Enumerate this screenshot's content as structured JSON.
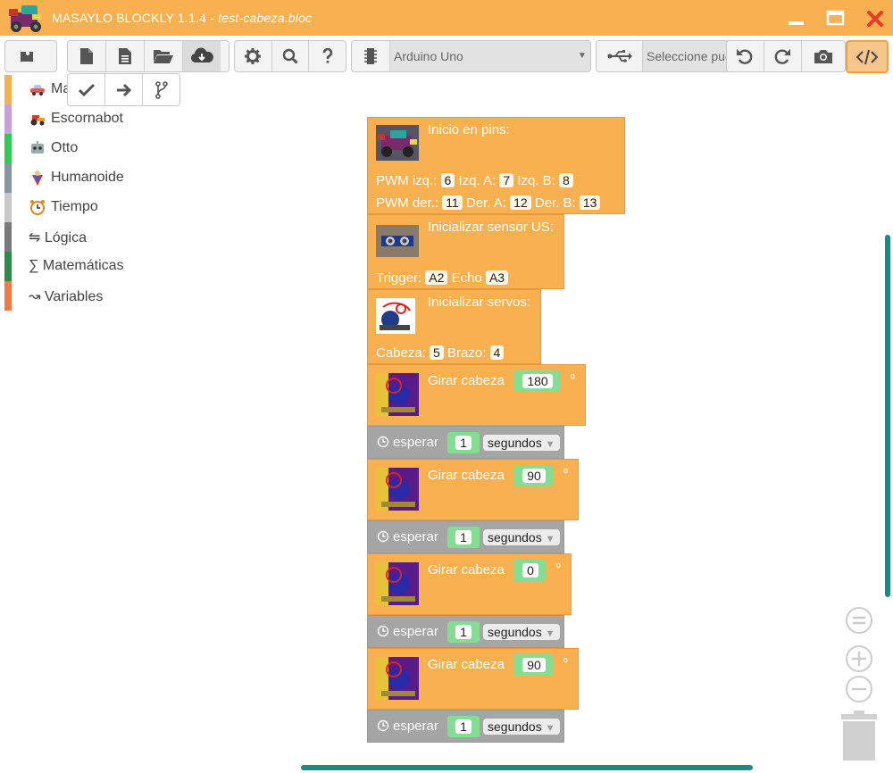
{
  "window": {
    "title": "MASAYLO BLOCKLY 1.1.4 - ",
    "file": "test-cabeza.bloc"
  },
  "toolbar": {
    "board_value": "Arduino Uno",
    "port_placeholder": "Seleccione puerto"
  },
  "categories": [
    {
      "label": "Masaylo",
      "color": "#f9b050"
    },
    {
      "label": "Escornabot",
      "color": "#c9a0dc"
    },
    {
      "label": "Otto",
      "color": "#2ecc52"
    },
    {
      "label": "Humanoide",
      "color": "#8795a5"
    },
    {
      "label": "Tiempo",
      "color": "#c8c8c8"
    },
    {
      "label": "Lógica",
      "color": "#7a7a7a"
    },
    {
      "label": "Matemáticas",
      "color": "#2e8b4a"
    },
    {
      "label": "Variables",
      "color": "#f07a4a"
    }
  ],
  "blocks": {
    "pins": {
      "title": "Inicio en pins:",
      "pwm_izq": "PWM izq.:",
      "pwm_izq_val": "6",
      "izq_a": "Izq. A:",
      "izq_a_val": "7",
      "izq_b": "Izq. B:",
      "izq_b_val": "8",
      "pwm_der": "PWM der.:",
      "pwm_der_val": "11",
      "der_a": "Der. A:",
      "der_a_val": "12",
      "der_b": "Der. B:",
      "der_b_val": "13"
    },
    "sensor": {
      "title": "Inicializar sensor US:",
      "trigger": "Trigger:",
      "trigger_val": "A2",
      "echo": "Echo",
      "echo_val": "A3"
    },
    "servos": {
      "title": "Inicializar servos:",
      "cabeza": "Cabeza:",
      "cabeza_val": "5",
      "brazo": "Brazo:",
      "brazo_val": "4"
    },
    "girar_label": "Girar cabeza",
    "degree": "º",
    "esperar_label": "esperar",
    "segundos": "segundos",
    "wait_val": "1",
    "girar_vals": [
      "180",
      "90",
      "0",
      "90"
    ]
  }
}
